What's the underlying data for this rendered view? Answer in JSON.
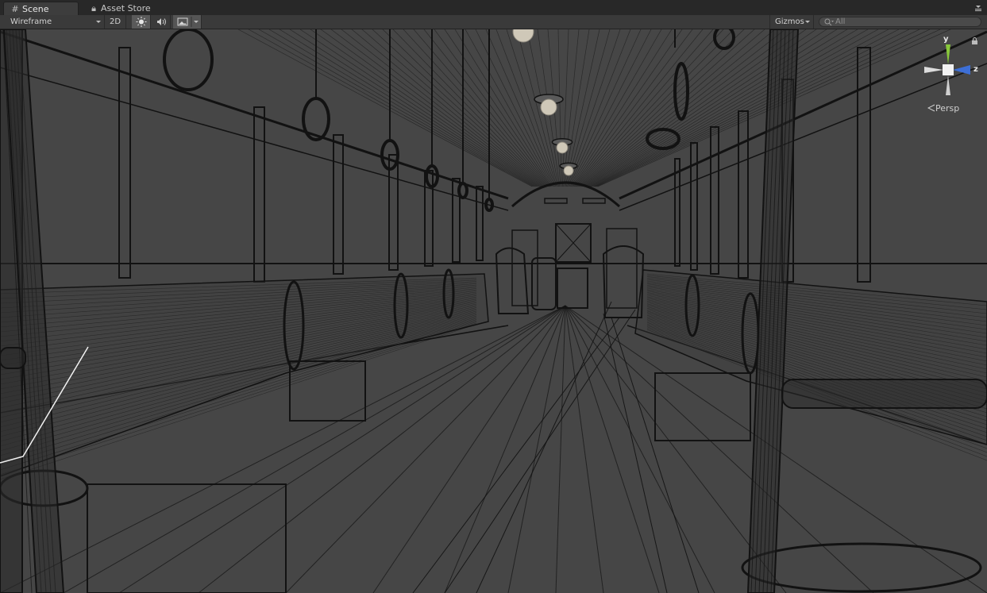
{
  "tabs": [
    {
      "label": "Scene",
      "icon": "grid-icon",
      "active": true
    },
    {
      "label": "Asset Store",
      "icon": "bag-icon",
      "active": false
    }
  ],
  "toolbar": {
    "shading_mode": "Wireframe",
    "mode_2d": "2D",
    "lighting_icon": "sun-icon",
    "audio_icon": "speaker-icon",
    "effects_icon": "image-icon",
    "gizmos_label": "Gizmos",
    "search_placeholder": "All"
  },
  "gizmo": {
    "y_label": "y",
    "z_label": "z",
    "projection_label": "Persp",
    "lock_icon": "lock-icon"
  },
  "colors": {
    "viewport_bg": "#464646",
    "wire": "#121212",
    "y_axis": "#88c83a",
    "z_axis": "#3d6fd6",
    "x_axis": "#d9d9d9"
  }
}
